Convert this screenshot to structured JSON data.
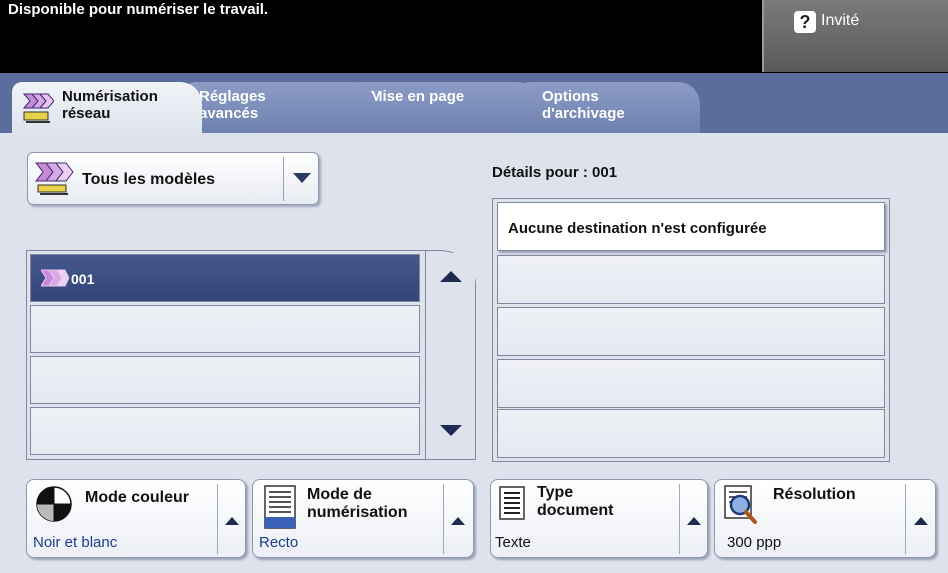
{
  "header": {
    "status": "Disponible pour numériser le travail.",
    "user_label": "Invité",
    "user_icon": "help-question-icon"
  },
  "tabs": [
    {
      "label_line1": "Numérisation",
      "label_line2": "réseau",
      "active": true,
      "icon": "network-scan-icon"
    },
    {
      "label_line1": "Réglages",
      "label_line2": "avancés",
      "active": false
    },
    {
      "label_line1": "Mise en page",
      "label_line2": "",
      "active": false
    },
    {
      "label_line1": "Options",
      "label_line2": "d'archivage",
      "active": false
    }
  ],
  "templates": {
    "dropdown_label": "Tous les modèles",
    "dropdown_icon": "network-scan-icon",
    "list": [
      {
        "label": "001",
        "selected": true,
        "icon": "scan-template-icon"
      },
      {
        "label": "",
        "selected": false
      },
      {
        "label": "",
        "selected": false
      },
      {
        "label": "",
        "selected": false
      }
    ]
  },
  "details": {
    "title_prefix": "Détails pour : ",
    "title_value": "001",
    "rows": [
      "Aucune destination n'est configurée",
      "",
      "",
      "",
      ""
    ]
  },
  "buttons": {
    "color_mode": {
      "title": "Mode couleur",
      "value": "Noir et blanc",
      "icon": "color-mode-icon"
    },
    "scan_mode": {
      "title_line1": "Mode de",
      "title_line2": "numérisation",
      "value": "Recto",
      "icon": "scan-mode-icon"
    },
    "doc_type": {
      "title_line1": "Type",
      "title_line2": "document",
      "value": "Texte",
      "icon": "document-type-icon"
    },
    "resolution": {
      "title": "Résolution",
      "value": "300 ppp",
      "icon": "resolution-magnifier-icon"
    }
  },
  "colors": {
    "tab_bar": "#5a6d9c",
    "selected_row": "#3a4b80",
    "panel_bg": "#dde2ec",
    "value_text": "#1c3b8c"
  }
}
